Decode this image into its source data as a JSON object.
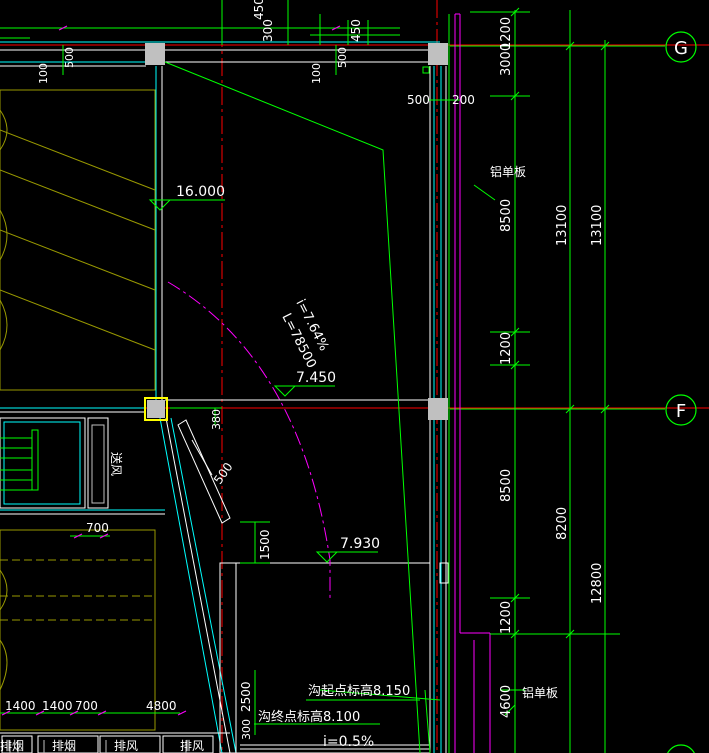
{
  "grid_axes": {
    "g": "G",
    "f": "F"
  },
  "elevations": {
    "e1": "16.000",
    "e2": "7.450",
    "e3": "7.930"
  },
  "ramp": {
    "slope": "i=7.64%",
    "length": "L=78500"
  },
  "labels": {
    "aluminum_panel": "铝单板",
    "air_supply": "送风",
    "start_elev": "沟起点标高8.150",
    "end_elev": "沟终点标高8.100",
    "gradient": "i=0.5%",
    "smoke_exhaust": "排烟",
    "exhaust": "排风"
  },
  "dims_right_col1": {
    "d1200a": "1200",
    "d3000": "3000",
    "d8500a": "8500",
    "d1200b": "1200",
    "d8500b": "8500",
    "d1200c": "1200",
    "d4600": "4600"
  },
  "dims_right_col2": {
    "d13100a": "13100",
    "d8200": "8200"
  },
  "dims_right_col3": {
    "d13100b": "13100",
    "d12800": "12800"
  },
  "dims_top": {
    "t450a": "450",
    "t300": "300",
    "t450b": "450",
    "t500a": "500",
    "t100a": "100",
    "t500b": "500",
    "t100b": "100"
  },
  "dims_misc": {
    "m500a": "500",
    "m200": "200",
    "m380": "380",
    "m500b": "500",
    "m700": "700",
    "m1500": "1500",
    "m2500": "2500",
    "m300": "300"
  },
  "dims_bottom": {
    "b1400a": "1400",
    "b1400b": "1400",
    "b700": "700",
    "b4800": "4800"
  },
  "colors": {
    "background": "#000000",
    "green": "#00ff00",
    "magenta": "#ff00ff",
    "cyan": "#00ffff",
    "red": "#ff0000",
    "yellow": "#ffff00",
    "olive": "#999900",
    "gray": "#c0c0c0"
  }
}
